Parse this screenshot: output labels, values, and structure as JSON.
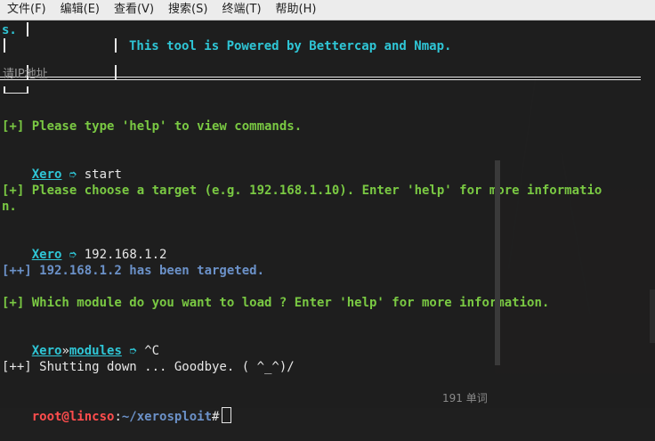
{
  "menu": {
    "items": [
      "文件(F)",
      "编辑(E)",
      "查看(V)",
      "搜索(S)",
      "终端(T)",
      "帮助(H)"
    ]
  },
  "terminal": {
    "top_fragment": "s.",
    "banner": "This tool is Powered by Bettercap and Nmap.",
    "ghost_text": "请IP地址",
    "help_hint": "[+] Please type 'help' to view commands.",
    "prompt_name": "Xero",
    "prompt_arrow": "➮",
    "cmd_start": "start",
    "choose_target_1": "[+] Please choose a target (e.g. 192.168.1.10). Enter 'help' for more informatio",
    "choose_target_2": "n.",
    "cmd_target": "192.168.1.2",
    "targeted": "[++] 192.168.1.2 has been targeted.",
    "module_prompt": "[+] Which module do you want to load ? Enter 'help' for more information.",
    "prompt_sep": "»",
    "prompt_modules": "modules",
    "cmd_interrupt": "^C",
    "shutdown": "[++] Shutting down ... Goodbye. ( ^_^)/",
    "shell_user": "root@lincso",
    "shell_colon": ":",
    "shell_path": "~/xerosploit",
    "shell_hash": "#",
    "word_count": "191 单词"
  }
}
